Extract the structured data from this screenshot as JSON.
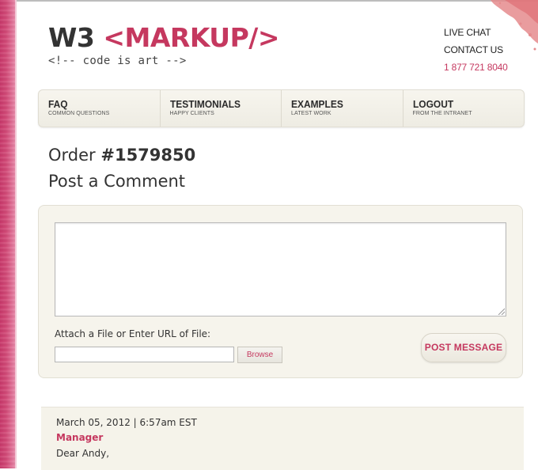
{
  "brand": {
    "logo_w3": "W3",
    "logo_markup": "<MARKUP/>",
    "tagline": "<!-- code is art -->",
    "accent_color": "#c5385f"
  },
  "header_links": {
    "live_chat": "LIVE CHAT",
    "contact_us": "CONTACT US",
    "phone": "1 877 721 8040"
  },
  "nav": {
    "items": [
      {
        "label": "FAQ",
        "sub": "COMMON QUESTIONS"
      },
      {
        "label": "TESTIMONIALS",
        "sub": "HAPPY CLIENTS"
      },
      {
        "label": "EXAMPLES",
        "sub": "LATEST WORK"
      },
      {
        "label": "LOGOUT",
        "sub": "FROM THE INTRANET"
      }
    ]
  },
  "order": {
    "prefix": "Order ",
    "number": "#1579850"
  },
  "comment_form": {
    "title": "Post a Comment",
    "textarea_value": "",
    "attach_label": "Attach a File or Enter URL of File:",
    "file_value": "",
    "browse_label": "Browse",
    "post_label": "POST MESSAGE"
  },
  "comments": [
    {
      "date": "March 05, 2012 | 6:57am EST",
      "author": "Manager",
      "body": "Dear Andy,"
    }
  ]
}
